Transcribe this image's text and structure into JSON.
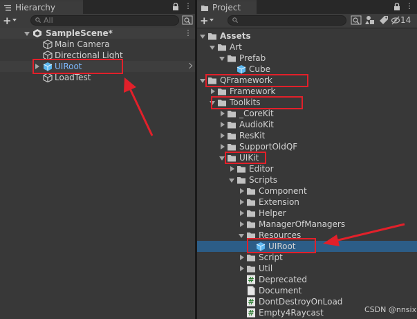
{
  "hierarchy": {
    "tab_title": "Hierarchy",
    "search_placeholder": "All",
    "scene_name": "SampleScene*",
    "items": [
      {
        "label": "Main Camera"
      },
      {
        "label": "Directional Light"
      },
      {
        "label": "UIRoot"
      },
      {
        "label": "LoadTest"
      }
    ]
  },
  "project": {
    "tab_title": "Project",
    "hidden_count": "14",
    "tree": [
      {
        "label": "Assets"
      },
      {
        "label": "Art"
      },
      {
        "label": "Prefab"
      },
      {
        "label": "Cube"
      },
      {
        "label": "QFramework"
      },
      {
        "label": "Framework"
      },
      {
        "label": "Toolkits"
      },
      {
        "label": "_CoreKit"
      },
      {
        "label": "AudioKit"
      },
      {
        "label": "ResKit"
      },
      {
        "label": "SupportOldQF"
      },
      {
        "label": "UIKit"
      },
      {
        "label": "Editor"
      },
      {
        "label": "Scripts"
      },
      {
        "label": "Component"
      },
      {
        "label": "Extension"
      },
      {
        "label": "Helper"
      },
      {
        "label": "ManagerOfManagers"
      },
      {
        "label": "Resources"
      },
      {
        "label": "UIRoot"
      },
      {
        "label": "Script"
      },
      {
        "label": "Util"
      },
      {
        "label": "Deprecated"
      },
      {
        "label": "Document"
      },
      {
        "label": "DontDestroyOnLoad"
      },
      {
        "label": "Empty4Raycast"
      }
    ]
  },
  "watermark": "CSDN @nnsix",
  "colors": {
    "highlight": "#e2202a",
    "selection": "#2c5d87",
    "selected_text": "#7fb9ff"
  }
}
